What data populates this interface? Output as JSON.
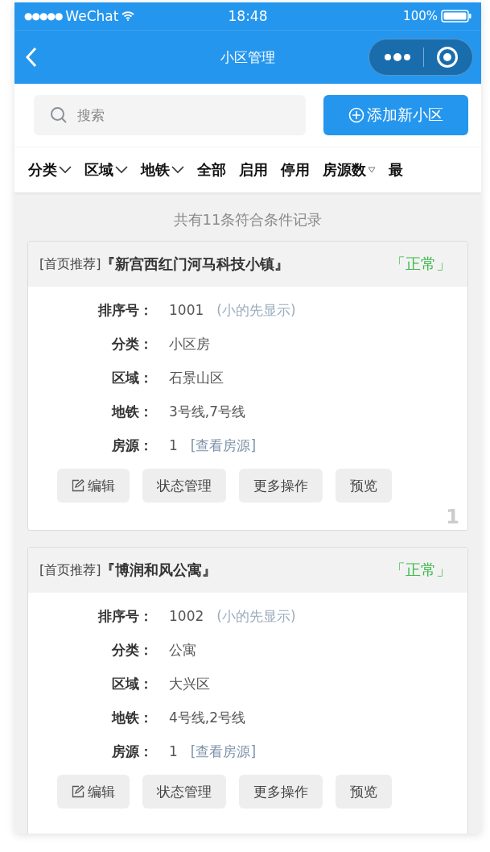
{
  "status_bar": {
    "signal": "●●●●●",
    "carrier": "WeChat",
    "time": "18:48",
    "battery": "100%"
  },
  "nav": {
    "title": "小区管理"
  },
  "search": {
    "placeholder": "搜索"
  },
  "add_button": {
    "label": "添加新小区"
  },
  "filters": [
    {
      "label": "分类",
      "kind": "dropdown"
    },
    {
      "label": "区域",
      "kind": "dropdown"
    },
    {
      "label": "地铁",
      "kind": "dropdown"
    },
    {
      "label": "全部",
      "kind": "plain"
    },
    {
      "label": "启用",
      "kind": "plain"
    },
    {
      "label": "停用",
      "kind": "plain"
    },
    {
      "label": "房源数",
      "kind": "sort"
    },
    {
      "label": "最",
      "kind": "plain"
    }
  ],
  "record_count": "共有11条符合条件记录",
  "cards": [
    {
      "tag": "[首页推荐]",
      "name": "『新宫西红门河马科技小镇』",
      "status": {
        "text": "「正常」",
        "kind": "normal"
      },
      "fields": [
        {
          "label": "排序号：",
          "value": "1001",
          "note": "(小的先显示)",
          "kind": "note"
        },
        {
          "label": "分类：",
          "value": "小区房"
        },
        {
          "label": "区域：",
          "value": "石景山区"
        },
        {
          "label": "地铁：",
          "value": "3号线,7号线"
        },
        {
          "label": "房源：",
          "value": "1",
          "note": "[查看房源]",
          "kind": "link"
        }
      ],
      "buttons": [
        {
          "label": "编辑",
          "kind": "edit"
        },
        {
          "label": "状态管理"
        },
        {
          "label": "更多操作"
        },
        {
          "label": "预览"
        }
      ],
      "index": "1"
    },
    {
      "tag": "[首页推荐]",
      "name": "『博润和风公寓』",
      "status": {
        "text": "「正常」",
        "kind": "normal"
      },
      "fields": [
        {
          "label": "排序号：",
          "value": "1002",
          "note": "(小的先显示)",
          "kind": "note"
        },
        {
          "label": "分类：",
          "value": "公寓"
        },
        {
          "label": "区域：",
          "value": "大兴区"
        },
        {
          "label": "地铁：",
          "value": "4号线,2号线"
        },
        {
          "label": "房源：",
          "value": "1",
          "note": "[查看房源]",
          "kind": "link"
        }
      ],
      "buttons": [
        {
          "label": "编辑",
          "kind": "edit"
        },
        {
          "label": "状态管理"
        },
        {
          "label": "更多操作"
        },
        {
          "label": "预览"
        }
      ]
    }
  ]
}
